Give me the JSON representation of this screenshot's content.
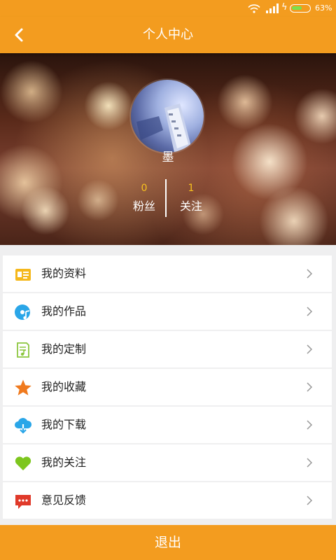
{
  "status_bar": {
    "battery_percent": "63%",
    "battery_level": 0.63,
    "charging_symbol": "ϟ"
  },
  "header": {
    "title": "个人中心"
  },
  "profile": {
    "username": "墨",
    "fans_count": "0",
    "fans_label": "粉丝",
    "following_count": "1",
    "following_label": "关注"
  },
  "menu": {
    "items": [
      {
        "label": "我的资料",
        "icon": "profile-card-icon",
        "color": "#f5b81c"
      },
      {
        "label": "我的作品",
        "icon": "music-disc-icon",
        "color": "#2aa6e8"
      },
      {
        "label": "我的定制",
        "icon": "custom-document-icon",
        "color": "#8cc63f"
      },
      {
        "label": "我的收藏",
        "icon": "star-icon",
        "color": "#f07a1e"
      },
      {
        "label": "我的下载",
        "icon": "cloud-download-icon",
        "color": "#2aa6e8"
      },
      {
        "label": "我的关注",
        "icon": "heart-icon",
        "color": "#7dc61e"
      },
      {
        "label": "意见反馈",
        "icon": "feedback-chat-icon",
        "color": "#e03a2a"
      }
    ]
  },
  "footer": {
    "logout_label": "退出"
  },
  "colors": {
    "accent": "#f39c1f",
    "stat_value": "#f8c21e"
  }
}
